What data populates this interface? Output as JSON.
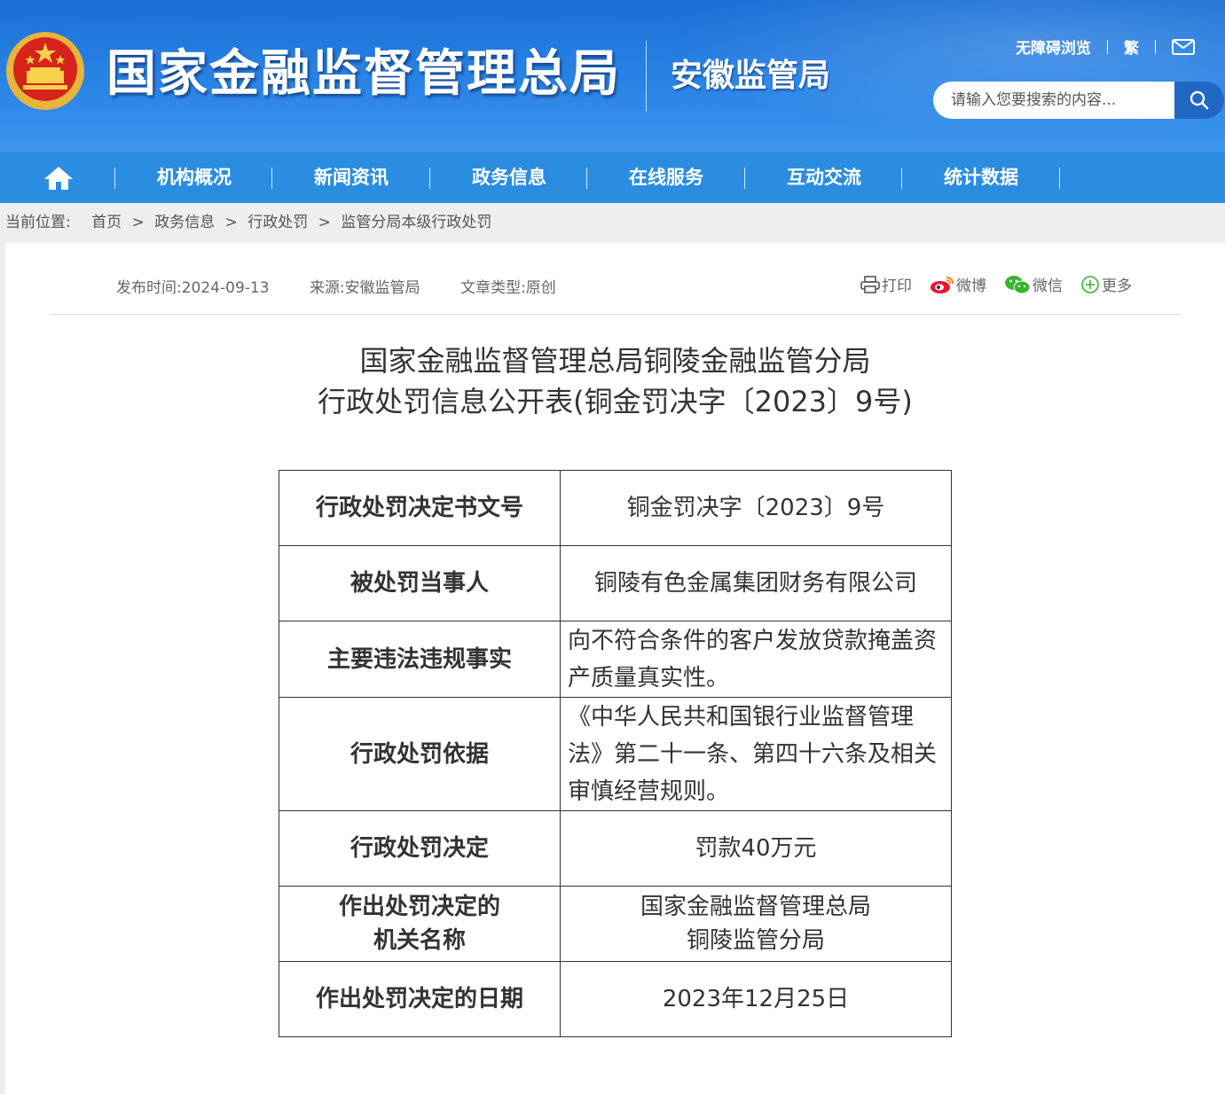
{
  "header": {
    "site_title": "国家金融监督管理总局",
    "bureau": "安徽监管局",
    "accessibility_link": "无障碍浏览",
    "traditional_link": "繁",
    "search_placeholder": "请输入您要搜索的内容..."
  },
  "nav": {
    "items": [
      "机构概况",
      "新闻资讯",
      "政务信息",
      "在线服务",
      "互动交流",
      "统计数据"
    ]
  },
  "breadcrumb": {
    "label": "当前位置:",
    "items": [
      "首页",
      "政务信息",
      "行政处罚",
      "监管分局本级行政处罚"
    ],
    "separator": ">"
  },
  "article": {
    "publish_time": "发布时间:2024-09-13",
    "source": "来源:安徽监管局",
    "type": "文章类型:原创",
    "share": {
      "print": "打印",
      "weibo": "微博",
      "wechat": "微信",
      "more": "更多"
    },
    "title_line1": "国家金融监督管理总局铜陵金融监管分局",
    "title_line2": "行政处罚信息公开表(铜金罚决字〔2023〕9号)",
    "table": [
      {
        "key": "行政处罚决定书文号",
        "value": "铜金罚决字〔2023〕9号"
      },
      {
        "key": "被处罚当事人",
        "value": "铜陵有色金属集团财务有限公司"
      },
      {
        "key": "主要违法违规事实",
        "value": "向不符合条件的客户发放贷款掩盖资产质量真实性。"
      },
      {
        "key": "行政处罚依据",
        "value": "《中华人民共和国银行业监督管理法》第二十一条、第四十六条及相关审慎经营规则。"
      },
      {
        "key": "行政处罚决定",
        "value": "罚款40万元"
      },
      {
        "key_line1": "作出处罚决定的",
        "key_line2": "机关名称",
        "value_line1": "国家金融监督管理总局",
        "value_line2": "铜陵监管分局"
      },
      {
        "key": "作出处罚决定的日期",
        "value": "2023年12月25日"
      }
    ]
  },
  "colors": {
    "header_blue": "#1a6fd6",
    "nav_blue": "#2b8de0",
    "search_button": "#2168c5"
  }
}
